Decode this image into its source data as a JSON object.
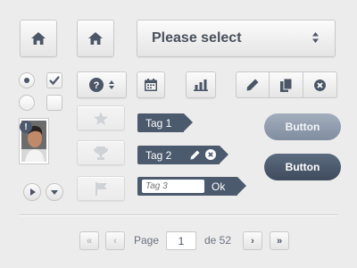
{
  "colors": {
    "accent": "#4c5a6e",
    "button_light": "#8a97a9",
    "button_dark": "#4a566a",
    "background": "#ececec"
  },
  "toolbar": {
    "home_icon": "home-icon",
    "select": {
      "value": "Please select",
      "icon": "up-down-arrows-icon"
    },
    "help_icon": "question-circle-icon",
    "icons": [
      "calendar-icon",
      "bar-chart-icon"
    ],
    "edit_group": [
      "pencil-icon",
      "copy-icon",
      "close-circle-icon"
    ]
  },
  "form": {
    "radios": [
      {
        "checked": true
      },
      {
        "checked": false
      }
    ],
    "checkboxes": [
      {
        "checked": true
      },
      {
        "checked": false
      }
    ]
  },
  "avatar": {
    "badge": "!"
  },
  "disabled_buttons": [
    "star-icon",
    "trophy-icon",
    "flag-icon"
  ],
  "tags": [
    {
      "label": "Tag 1"
    },
    {
      "label": "Tag 2"
    },
    {
      "placeholder": "Tag 3",
      "ok_label": "Ok"
    }
  ],
  "buttons": {
    "light": "Button",
    "dark": "Button"
  },
  "pagination": {
    "first": "«",
    "prev": "‹",
    "page_label": "Page",
    "current_page": "1",
    "of_label": "de 52",
    "next": "›",
    "last": "»"
  }
}
